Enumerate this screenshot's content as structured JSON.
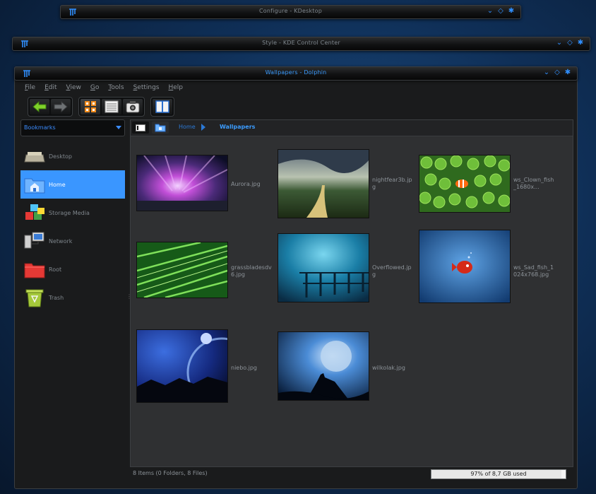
{
  "windows": [
    {
      "title": "Configure - KDesktop"
    },
    {
      "title": "Style - KDE Control Center"
    },
    {
      "title": "Wallpapers - Dolphin"
    }
  ],
  "window_buttons": [
    "minimize-icon",
    "maximize-icon",
    "close-icon"
  ],
  "menubar": [
    "File",
    "Edit",
    "View",
    "Go",
    "Tools",
    "Settings",
    "Help"
  ],
  "toolbar": {
    "back": "back-icon",
    "forward": "forward-icon",
    "icons_view": "icons-view-icon",
    "details_view": "details-view-icon",
    "preview": "preview-camera-icon",
    "split": "split-view-icon"
  },
  "sidebar": {
    "selector_label": "Bookmarks",
    "places": [
      {
        "label": "Desktop",
        "icon": "desktop-icon"
      },
      {
        "label": "Home",
        "icon": "home-folder-icon"
      },
      {
        "label": "Storage Media",
        "icon": "storage-media-icon"
      },
      {
        "label": "Network",
        "icon": "network-icon"
      },
      {
        "label": "Root",
        "icon": "root-folder-icon"
      },
      {
        "label": "Trash",
        "icon": "trash-icon"
      }
    ],
    "selected": "Home"
  },
  "breadcrumb": {
    "items": [
      "Home",
      "Wallpapers"
    ]
  },
  "files": [
    {
      "name": "Aurora.jpg"
    },
    {
      "name": "nightfear3b.jpg"
    },
    {
      "name": "ws_Clown_fish_1680x..."
    },
    {
      "name": "grassbladesdv6.jpg"
    },
    {
      "name": "Overflowed.jpg"
    },
    {
      "name": "ws_Sad_fish_1024x768.jpg"
    },
    {
      "name": "niebo.jpg"
    },
    {
      "name": "wilkolak.jpg"
    }
  ],
  "status": {
    "text": "8 Items (0 Folders, 8 Files)",
    "disk_label": "97% of 8,7 GB used",
    "disk_fraction": 0.97
  },
  "colors": {
    "accent": "#3a96ff",
    "window_bg": "#1a1b1c",
    "view_bg": "#2f3032"
  }
}
